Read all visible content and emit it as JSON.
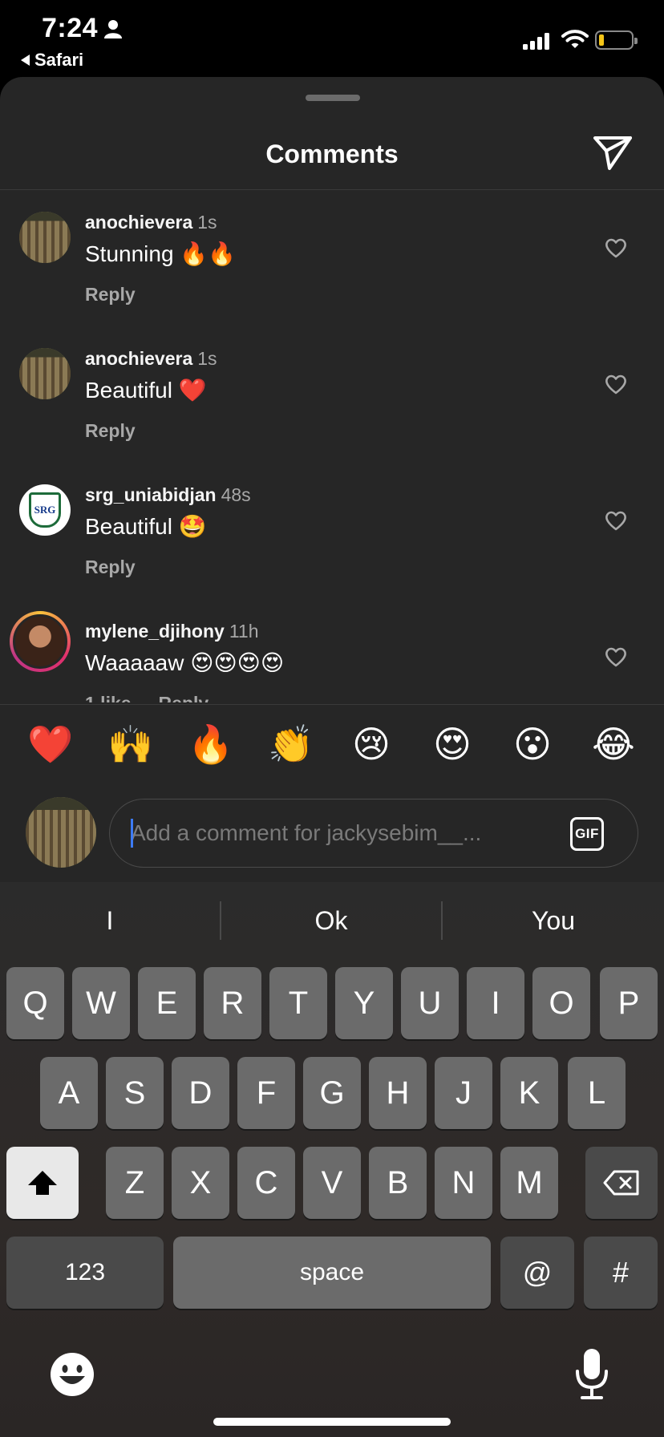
{
  "status_bar": {
    "time": "7:24",
    "back_app": "Safari"
  },
  "sheet": {
    "title": "Comments"
  },
  "comments": [
    {
      "username": "anochievera",
      "time": "1s",
      "text": "Stunning 🔥🔥",
      "likes": "",
      "reply_label": "Reply",
      "avatar": "forest"
    },
    {
      "username": "anochievera",
      "time": "1s",
      "text": "Beautiful ❤️",
      "likes": "",
      "reply_label": "Reply",
      "avatar": "forest"
    },
    {
      "username": "srg_uniabidjan",
      "time": "48s",
      "text": "Beautiful 🤩",
      "likes": "",
      "reply_label": "Reply",
      "avatar": "srg"
    },
    {
      "username": "mylene_djihony",
      "time": "11h",
      "text": "Waaaaaw 😍😍😍😍",
      "likes": "1 like",
      "reply_label": "Reply",
      "avatar": "portrait"
    }
  ],
  "srg_logo_text": "SRG",
  "emoji_bar": [
    "❤️",
    "🙌",
    "🔥",
    "👏",
    "😢",
    "😍",
    "😮",
    "😂"
  ],
  "composer": {
    "placeholder": "Add a comment for jackysebim__...",
    "gif_label": "GIF"
  },
  "keyboard": {
    "suggestions": [
      "I",
      "Ok",
      "You"
    ],
    "row1": [
      "Q",
      "W",
      "E",
      "R",
      "T",
      "Y",
      "U",
      "I",
      "O",
      "P"
    ],
    "row2": [
      "A",
      "S",
      "D",
      "F",
      "G",
      "H",
      "J",
      "K",
      "L"
    ],
    "row3": [
      "Z",
      "X",
      "C",
      "V",
      "B",
      "N",
      "M"
    ],
    "numbers_label": "123",
    "space_label": "space",
    "at_label": "@",
    "hash_label": "#"
  }
}
